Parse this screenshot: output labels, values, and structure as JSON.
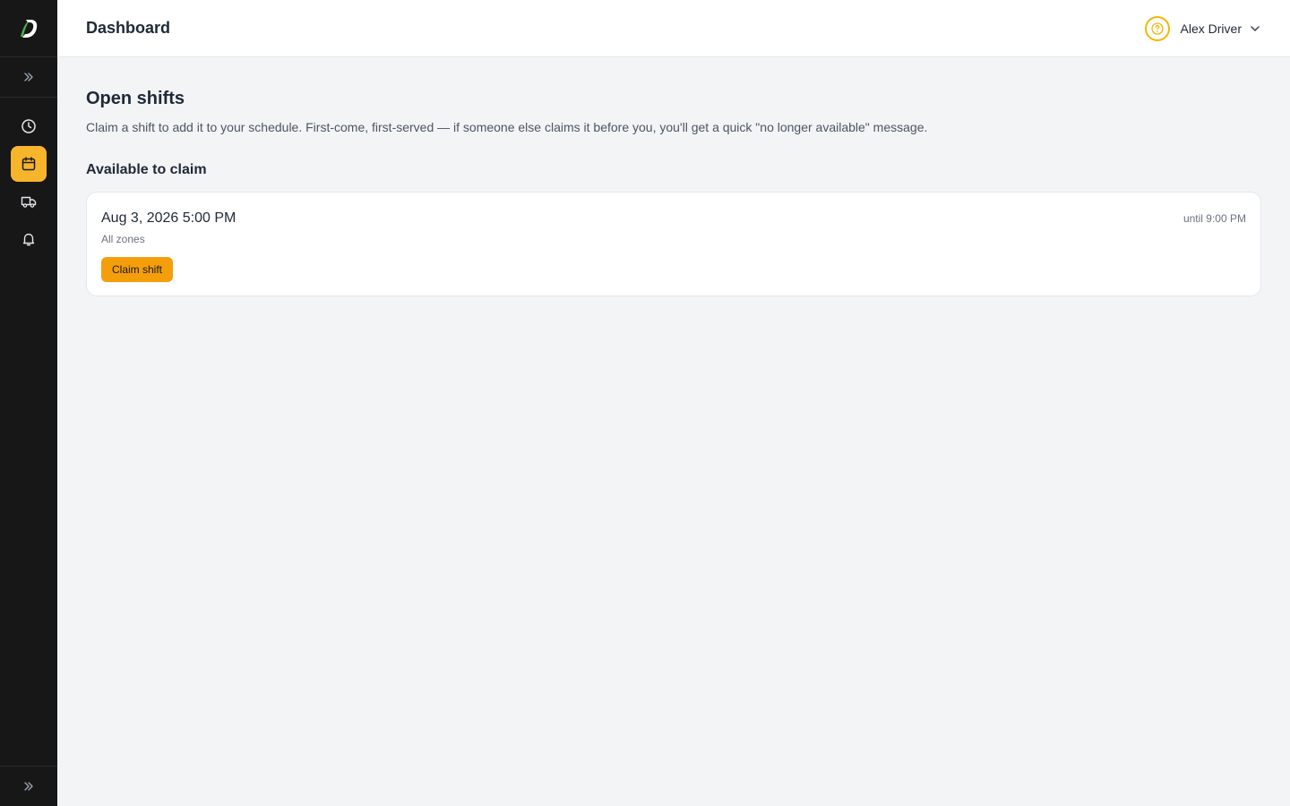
{
  "sidebar": {
    "logo": "D",
    "expand_icon": "chevrons-right-icon",
    "items": [
      {
        "name": "clock",
        "icon": "clock-icon",
        "active": false
      },
      {
        "name": "calendar",
        "icon": "calendar-icon",
        "active": true
      },
      {
        "name": "truck",
        "icon": "truck-icon",
        "active": false
      },
      {
        "name": "bell",
        "icon": "bell-icon",
        "active": false
      }
    ]
  },
  "header": {
    "title": "Dashboard",
    "help_icon": "help-circle-icon",
    "user_name": "Alex Driver",
    "dropdown_icon": "chevron-down-icon"
  },
  "main": {
    "title": "Open shifts",
    "description": "Claim a shift to add it to your schedule. First-come, first-served — if someone else claims it before you, you'll get a quick \"no longer available\" message.",
    "section_title": "Available to claim",
    "shifts": [
      {
        "date": "Aug 3, 2026 5:00 PM",
        "zone": "All zones",
        "until": "until 9:00 PM",
        "claim_label": "Claim shift"
      }
    ]
  },
  "colors": {
    "accent": "#f7b52c",
    "button": "#f59e0b",
    "sidebar_bg": "#171717"
  }
}
